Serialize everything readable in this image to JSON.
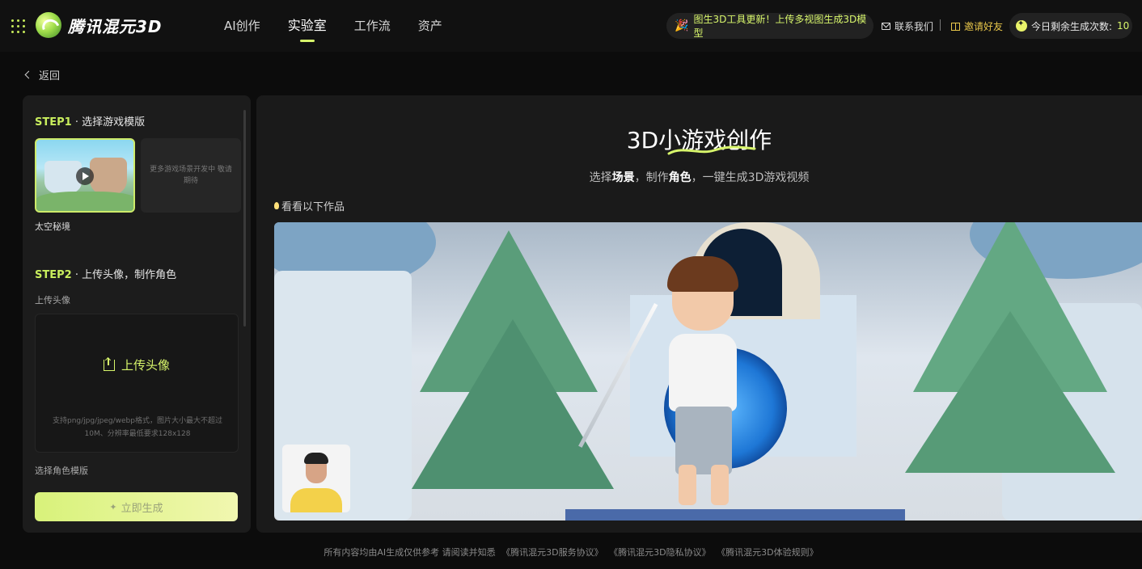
{
  "header": {
    "logo_text": "腾讯混元3D",
    "nav": [
      {
        "label": "AI创作",
        "active": false
      },
      {
        "label": "实验室",
        "active": true
      },
      {
        "label": "工作流",
        "active": false
      },
      {
        "label": "资产",
        "active": false
      }
    ],
    "announcement": "图生3D工具更新！上传多视图生成3D模型",
    "contact_label": "联系我们",
    "invite_label": "邀请好友",
    "quota_label": "今日剩余生成次数:",
    "quota_value": "10",
    "accent_color": "#d7f56b"
  },
  "back_label": "返回",
  "left_panel": {
    "step1": {
      "prefix": "STEP1",
      "title": "· 选择游戏模版"
    },
    "templates": [
      {
        "label": "太空秘境",
        "selected": true,
        "icon": "play-icon"
      },
      {
        "label": "更多游戏场景开发中 敬请期待",
        "selected": false
      }
    ],
    "step2": {
      "prefix": "STEP2",
      "title": "· 上传头像，制作角色"
    },
    "upload_label": "上传头像",
    "upload_button": "上传头像",
    "upload_hint": "支持png/jpg/jpeg/webp格式，图片大小最大不超过10M、分辨率最低要求128x128",
    "choose_template_label": "选择角色模版",
    "generate_button": "立即生成"
  },
  "main": {
    "title": "3D小游戏创作",
    "subtitle_parts": [
      "选择",
      "场景",
      "，制作",
      "角色",
      "，一键生成3D游戏视频"
    ],
    "works_label": "看看以下作品"
  },
  "footer": {
    "notice": "所有内容均由AI生成仅供参考 请阅读并知悉",
    "links": [
      "《腾讯混元3D服务协议》",
      "《腾讯混元3D隐私协议》",
      "《腾讯混元3D体验规则》"
    ]
  }
}
